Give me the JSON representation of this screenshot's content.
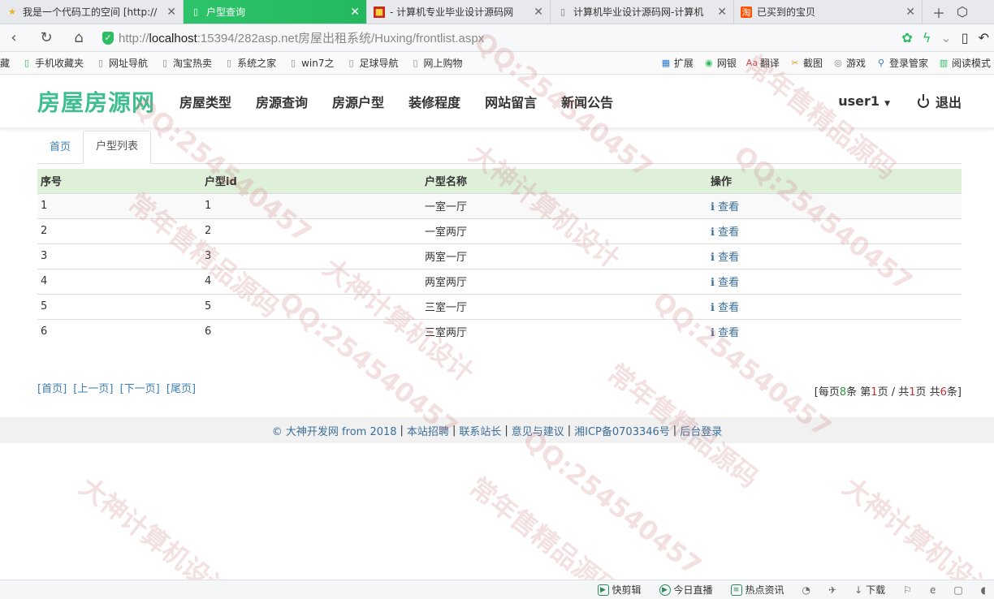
{
  "browser": {
    "tabs": [
      {
        "title": "我是一个代码工的空间 [http://",
        "icon": "star-icon",
        "active": false
      },
      {
        "title": "户型查询",
        "icon": "page-icon",
        "active": true
      },
      {
        "title": "- 计算机专业毕业设计源码网",
        "icon": "gift-icon",
        "active": false
      },
      {
        "title": "计算机毕业设计源码网-计算机",
        "icon": "page-icon",
        "active": false
      },
      {
        "title": "已买到的宝贝",
        "icon": "taobao-icon",
        "active": false
      }
    ],
    "url_scheme": "http://",
    "url_host": "localhost",
    "url_rest": ":15394/282asp.net房屋出租系统/Huxing/frontlist.aspx",
    "bookmarks": [
      "藏",
      "手机收藏夹",
      "网址导航",
      "淘宝热卖",
      "系统之家",
      "win7之",
      "足球导航",
      "网上购物"
    ],
    "toolbar": [
      "扩展",
      "网银",
      "翻译",
      "截图",
      "游戏",
      "登录管家",
      "阅读模式"
    ]
  },
  "site": {
    "brand": "房屋房源网",
    "menu": [
      "房屋类型",
      "房源查询",
      "房源户型",
      "装修程度",
      "网站留言",
      "新闻公告"
    ],
    "user": "user1",
    "logout": "退出"
  },
  "crumbs": {
    "home": "首页",
    "current": "户型列表"
  },
  "table": {
    "headers": [
      "序号",
      "户型id",
      "户型名称",
      "操作"
    ],
    "rows": [
      {
        "no": "1",
        "id": "1",
        "name": "一室一厅",
        "action": "查看"
      },
      {
        "no": "2",
        "id": "2",
        "name": "一室两厅",
        "action": "查看"
      },
      {
        "no": "3",
        "id": "3",
        "name": "两室一厅",
        "action": "查看"
      },
      {
        "no": "4",
        "id": "4",
        "name": "两室两厅",
        "action": "查看"
      },
      {
        "no": "5",
        "id": "5",
        "name": "三室一厅",
        "action": "查看"
      },
      {
        "no": "6",
        "id": "6",
        "name": "三室两厅",
        "action": "查看"
      }
    ]
  },
  "pager": {
    "first": "[首页]",
    "prev": "[上一页]",
    "next": "[下一页]",
    "last": "[尾页]",
    "info_1": "[每页",
    "per_page": "8",
    "info_2": "条 第",
    "page": "1",
    "info_3": "页 / 共",
    "pages": "1",
    "info_4": "页 共",
    "total": "6",
    "info_5": "条]"
  },
  "footer": [
    "© 大神开发网 from 2018",
    "本站招聘",
    "联系站长",
    "意见与建议",
    "湘ICP备0703346号",
    "后台登录"
  ],
  "statusbar": [
    "快剪辑",
    "今日直播",
    "热点资讯",
    "下载"
  ],
  "watermarks": [
    "QQ:254540457",
    "大神计算机设计",
    "常年售精品源码"
  ],
  "colors": {
    "brand": "#3fbf8f",
    "active_tab": "#23b85e",
    "table_header": "#dff0d8",
    "link": "#3a7fb9"
  }
}
